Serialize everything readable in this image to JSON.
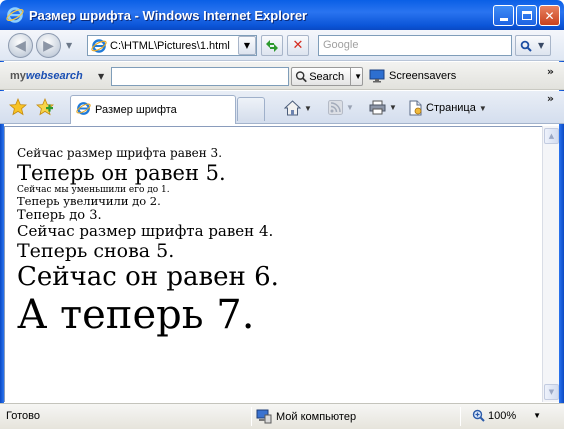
{
  "window": {
    "title": "Размер шрифта - Windows Internet Explorer"
  },
  "address_bar": {
    "url": "C:\\HTML\\Pictures\\1.html",
    "search_placeholder": "Google"
  },
  "toolbar": {
    "mywebsearch_logo_prefix": "my",
    "mywebsearch_logo_main": "websearch",
    "search_label": "Search",
    "screensavers_label": "Screensavers"
  },
  "tabs": [
    {
      "label": "Размер шрифта",
      "active": true
    }
  ],
  "command_bar": {
    "page_label": "Страница"
  },
  "content": {
    "lines": [
      {
        "text": "Сейчас размер шрифта равен 3.",
        "font_size": 3
      },
      {
        "text": "Теперь он равен 5.",
        "font_size": 5
      },
      {
        "text": "Сейчас мы уменьшили его до 1.",
        "font_size": 1
      },
      {
        "text": "Теперь увеличили до 2.",
        "font_size": 2
      },
      {
        "text": "Теперь до 3.",
        "font_size": 3
      },
      {
        "text": "Сейчас размер шрифта равен 4.",
        "font_size": 4
      },
      {
        "text": "Теперь снова 5.",
        "font_size": 5
      },
      {
        "text": "Сейчас он равен 6.",
        "font_size": 6
      },
      {
        "text": "А теперь 7.",
        "font_size": 7
      }
    ]
  },
  "status_bar": {
    "status_text": "Готово",
    "zone_text": "Мой компьютер",
    "zoom_text": "100%"
  },
  "colors": {
    "titlebar_blue": "#0a5fe6",
    "close_red": "#c9421e"
  }
}
